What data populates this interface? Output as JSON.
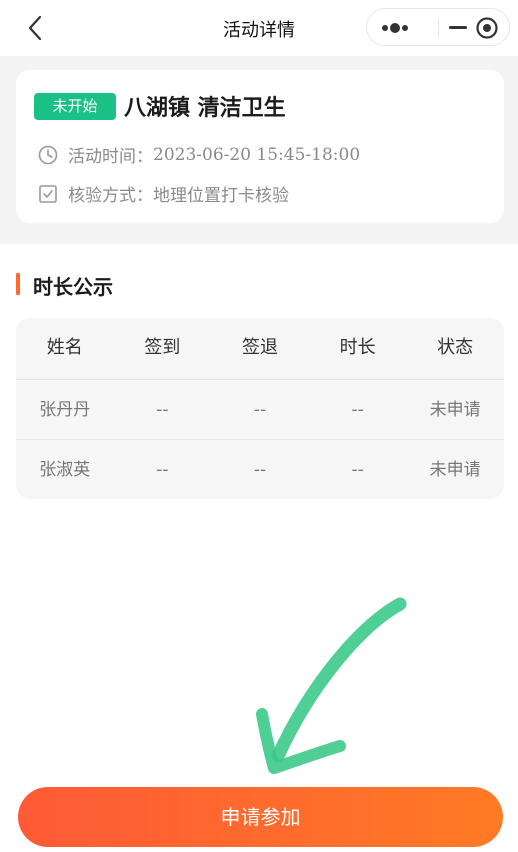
{
  "navbar": {
    "title": "活动详情",
    "back_icon": "chevron-left-icon",
    "more_icon": "more-dots-icon",
    "minimize_icon": "minus-icon",
    "close_icon": "target-close-icon"
  },
  "activity": {
    "status": "未开始",
    "status_color": "#1bc086",
    "title": "八湖镇 清洁卫生",
    "time_label": "活动时间：",
    "time_value": "2023-06-20 15:45-18:00",
    "verify_label": "核验方式：",
    "verify_value": "地理位置打卡核验",
    "time_icon": "clock-icon",
    "verify_icon": "checkbox-icon"
  },
  "section": {
    "title": "时长公示",
    "accent_color": "#ff6a2b"
  },
  "table": {
    "headers": [
      "姓名",
      "签到",
      "签退",
      "时长",
      "状态"
    ],
    "rows": [
      [
        "张丹丹",
        "--",
        "--",
        "--",
        "未申请"
      ],
      [
        "张淑英",
        "--",
        "--",
        "--",
        "未申请"
      ]
    ]
  },
  "annotation": {
    "icon": "green-arrow-icon",
    "color": "#3cc98a"
  },
  "footer": {
    "button_label": "申请参加",
    "button_color": "#ff5a36"
  }
}
